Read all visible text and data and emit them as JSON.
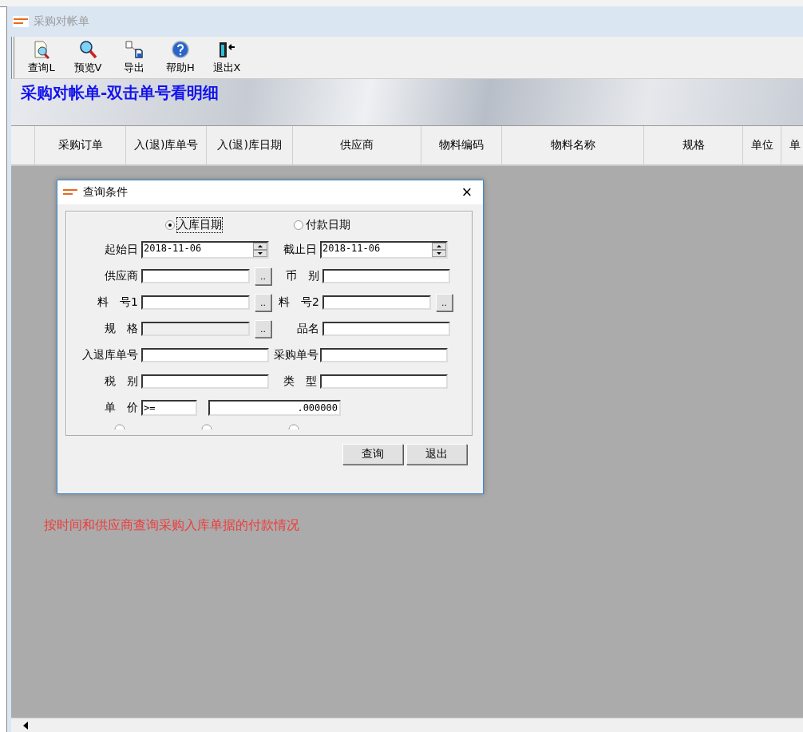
{
  "window": {
    "title": "采购对帐单"
  },
  "toolbar": [
    {
      "label": "查询L",
      "kind": "query"
    },
    {
      "label": "预览V",
      "kind": "preview"
    },
    {
      "label": "导出",
      "kind": "export"
    },
    {
      "label": "帮助H",
      "kind": "help"
    },
    {
      "label": "退出X",
      "kind": "exit"
    }
  ],
  "banner": {
    "title": "采购对帐单-双击单号看明细"
  },
  "table": {
    "columns": [
      "采购订单",
      "入(退)库单号",
      "入(退)库日期",
      "供应商",
      "物料编码",
      "物料名称",
      "规格",
      "单位",
      "单"
    ]
  },
  "hint": "按时间和供应商查询采购入库单据的付款情况",
  "dialog": {
    "title": "查询条件",
    "close": "×",
    "date_mode": [
      {
        "label": "入库日期",
        "selected": true
      },
      {
        "label": "付款日期",
        "selected": false
      }
    ],
    "rows": [
      {
        "left": {
          "label": "起始日",
          "kind": "date",
          "value": "2018-11-06"
        },
        "right": {
          "label": "截止日",
          "kind": "date",
          "value": "2018-11-06"
        }
      },
      {
        "left": {
          "label": "供应商",
          "kind": "lookup",
          "button": ".."
        },
        "right": {
          "label": "币　别",
          "kind": "text"
        }
      },
      {
        "left": {
          "label": "料　号1",
          "kind": "lookup",
          "button": ".."
        },
        "right": {
          "label": "料　号2",
          "kind": "lookup",
          "button": ".."
        }
      },
      {
        "left": {
          "label": "规　格",
          "kind": "lookup",
          "button": "..",
          "disabled": true
        },
        "right": {
          "label": "品名",
          "kind": "text"
        }
      },
      {
        "left": {
          "label": "入退库单号",
          "kind": "text"
        },
        "right": {
          "label": "采购单号",
          "kind": "text"
        }
      },
      {
        "left": {
          "label": "税　别",
          "kind": "text"
        },
        "right": {
          "label": "类　型",
          "kind": "text"
        }
      },
      {
        "left": {
          "label": "单　价",
          "kind": "price",
          "operator": ">=",
          "value": ".000000"
        }
      }
    ],
    "buttons": [
      "查询",
      "退出"
    ]
  }
}
